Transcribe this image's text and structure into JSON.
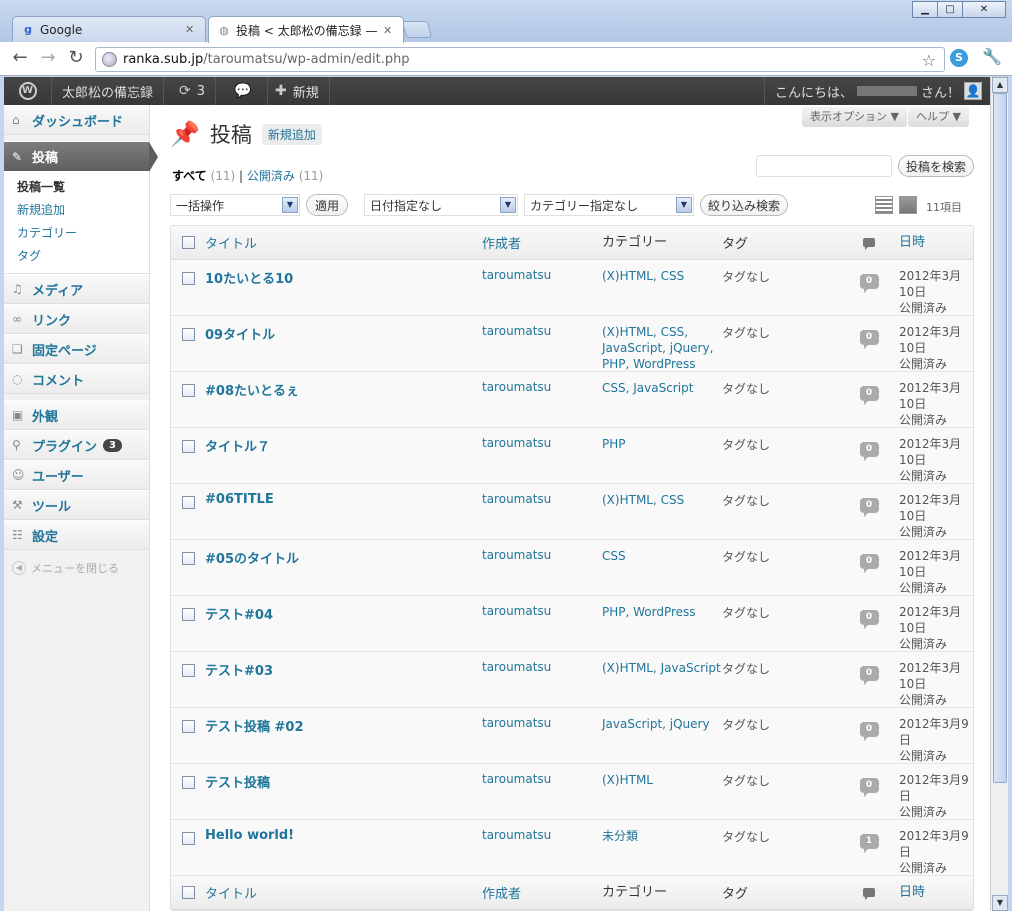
{
  "browser": {
    "tabs": [
      {
        "title": "Google",
        "icon": "google-favicon"
      },
      {
        "title": "投稿 < 太郎松の備忘録 — W",
        "icon": "globe-favicon"
      }
    ],
    "url_host": "ranka.sub.jp",
    "url_path": "/taroumatsu/wp-admin/edit.php"
  },
  "adminbar": {
    "site": "太郎松の備忘録",
    "updates": "3",
    "new": "新規",
    "greeting": "こんにちは、",
    "greeting_suffix": "さん！"
  },
  "menu": {
    "dashboard": "ダッシュボード",
    "posts": "投稿",
    "posts_sub": [
      "投稿一覧",
      "新規追加",
      "カテゴリー",
      "タグ"
    ],
    "media": "メディア",
    "links": "リンク",
    "pages": "固定ページ",
    "comments": "コメント",
    "appearance": "外観",
    "plugins": "プラグイン",
    "plugins_badge": "3",
    "users": "ユーザー",
    "tools": "ツール",
    "settings": "設定",
    "collapse": "メニューを閉じる"
  },
  "screen": {
    "options": "表示オプション ▼",
    "help": "ヘルプ ▼"
  },
  "page": {
    "title": "投稿",
    "add_new": "新規追加",
    "filter_all": "すべて",
    "filter_all_count": "(11)",
    "filter_sep": "|",
    "filter_published": "公開済み",
    "filter_published_count": "(11)",
    "search_button": "投稿を検索",
    "bulk": "一括操作",
    "apply": "適用",
    "date": "日付指定なし",
    "category": "カテゴリー指定なし",
    "filter_button": "絞り込み検索",
    "item_count": "11項目"
  },
  "table": {
    "headers": {
      "title": "タイトル",
      "author": "作成者",
      "categories": "カテゴリー",
      "tags": "タグ",
      "date": "日時"
    },
    "rows": [
      {
        "title": "10たいとる10",
        "author": "taroumatsu",
        "categories": "(X)HTML, CSS",
        "tags": "タグなし",
        "comments": "0",
        "date": "2012年3月10日",
        "status": "公開済み"
      },
      {
        "title": "09タイトル",
        "author": "taroumatsu",
        "categories": "(X)HTML, CSS, JavaScript, jQuery, PHP, WordPress",
        "tags": "タグなし",
        "comments": "0",
        "date": "2012年3月10日",
        "status": "公開済み"
      },
      {
        "title": "#08たいとるぇ",
        "author": "taroumatsu",
        "categories": "CSS, JavaScript",
        "tags": "タグなし",
        "comments": "0",
        "date": "2012年3月10日",
        "status": "公開済み"
      },
      {
        "title": "タイトル７",
        "author": "taroumatsu",
        "categories": "PHP",
        "tags": "タグなし",
        "comments": "0",
        "date": "2012年3月10日",
        "status": "公開済み"
      },
      {
        "title": "#06TITLE",
        "author": "taroumatsu",
        "categories": "(X)HTML, CSS",
        "tags": "タグなし",
        "comments": "0",
        "date": "2012年3月10日",
        "status": "公開済み"
      },
      {
        "title": "#05のタイトル",
        "author": "taroumatsu",
        "categories": "CSS",
        "tags": "タグなし",
        "comments": "0",
        "date": "2012年3月10日",
        "status": "公開済み"
      },
      {
        "title": "テスト#04",
        "author": "taroumatsu",
        "categories": "PHP, WordPress",
        "tags": "タグなし",
        "comments": "0",
        "date": "2012年3月10日",
        "status": "公開済み"
      },
      {
        "title": "テスト#03",
        "author": "taroumatsu",
        "categories": "(X)HTML, JavaScript",
        "tags": "タグなし",
        "comments": "0",
        "date": "2012年3月10日",
        "status": "公開済み"
      },
      {
        "title": "テスト投稿 #02",
        "author": "taroumatsu",
        "categories": "JavaScript, jQuery",
        "tags": "タグなし",
        "comments": "0",
        "date": "2012年3月9日",
        "status": "公開済み"
      },
      {
        "title": "テスト投稿",
        "author": "taroumatsu",
        "categories": "(X)HTML",
        "tags": "タグなし",
        "comments": "0",
        "date": "2012年3月9日",
        "status": "公開済み"
      },
      {
        "title": "Hello world!",
        "author": "taroumatsu",
        "categories": "未分類",
        "tags": "タグなし",
        "comments": "1",
        "date": "2012年3月9日",
        "status": "公開済み"
      }
    ]
  }
}
